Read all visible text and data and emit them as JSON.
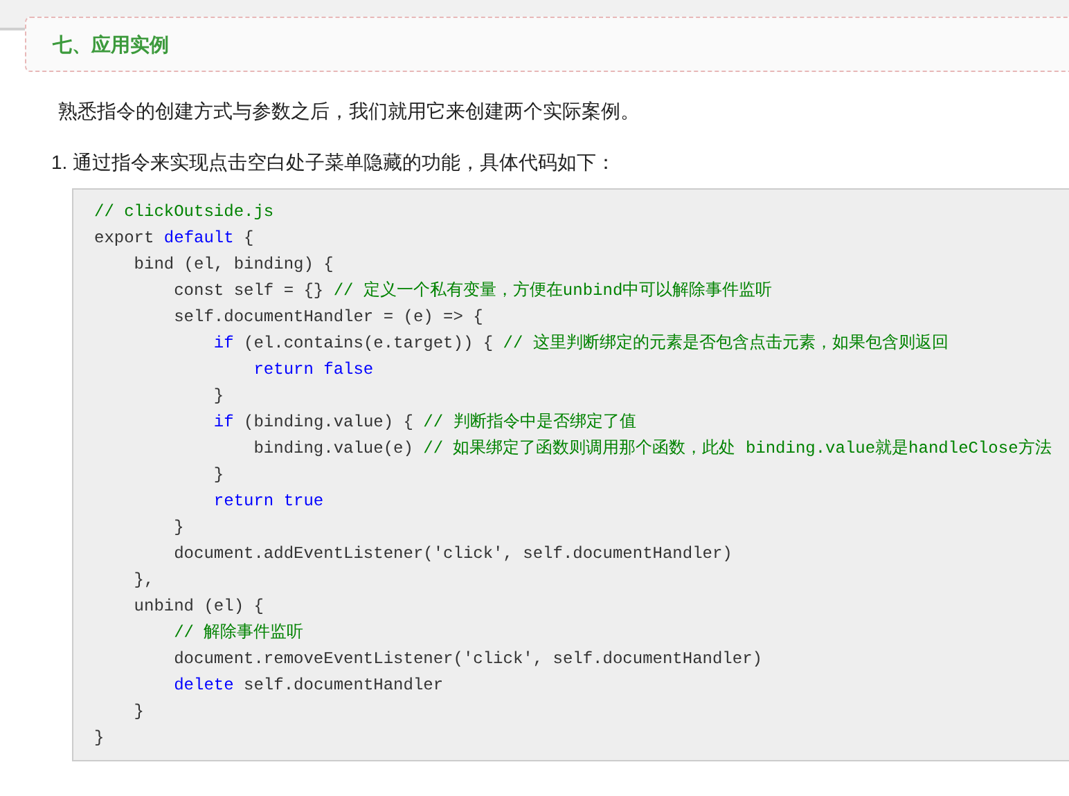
{
  "section_heading": "七、应用实例",
  "intro": "熟悉指令的创建方式与参数之后，我们就用它来创建两个实际案例。",
  "list_item": {
    "number": "1.",
    "text": "通过指令来实现点击空白处子菜单隐藏的功能，具体代码如下："
  },
  "code_lines": [
    [
      {
        "kind": "comment",
        "text": "// clickOutside.js"
      }
    ],
    [
      {
        "kind": "plain",
        "text": "export "
      },
      {
        "kind": "keyword",
        "text": "default"
      },
      {
        "kind": "plain",
        "text": " {"
      }
    ],
    [
      {
        "kind": "plain",
        "text": "    bind (el, binding) {"
      }
    ],
    [
      {
        "kind": "plain",
        "text": "        const self = {} "
      },
      {
        "kind": "comment",
        "text": "// 定义一个私有变量，方便在unbind中可以解除事件监听"
      }
    ],
    [
      {
        "kind": "plain",
        "text": "        self.documentHandler = (e) => {"
      }
    ],
    [
      {
        "kind": "keyword",
        "text": "            if"
      },
      {
        "kind": "plain",
        "text": " (el.contains(e.target)) { "
      },
      {
        "kind": "comment",
        "text": "// 这里判断绑定的元素是否包含点击元素，如果包含则返回"
      }
    ],
    [
      {
        "kind": "keyword",
        "text": "                return false"
      }
    ],
    [
      {
        "kind": "plain",
        "text": "            }"
      }
    ],
    [
      {
        "kind": "keyword",
        "text": "            if"
      },
      {
        "kind": "plain",
        "text": " (binding.value) { "
      },
      {
        "kind": "comment",
        "text": "// 判断指令中是否绑定了值"
      }
    ],
    [
      {
        "kind": "plain",
        "text": "                binding.value(e) "
      },
      {
        "kind": "comment",
        "text": "// 如果绑定了函数则调用那个函数，此处 binding.value就是handleClose方法"
      }
    ],
    [
      {
        "kind": "plain",
        "text": "            }"
      }
    ],
    [
      {
        "kind": "keyword",
        "text": "            return true"
      }
    ],
    [
      {
        "kind": "plain",
        "text": "        }"
      }
    ],
    [
      {
        "kind": "plain",
        "text": "        document.addEventListener('click', self.documentHandler)"
      }
    ],
    [
      {
        "kind": "plain",
        "text": "    },"
      }
    ],
    [
      {
        "kind": "plain",
        "text": "    unbind (el) {"
      }
    ],
    [
      {
        "kind": "comment",
        "text": "        // 解除事件监听"
      }
    ],
    [
      {
        "kind": "plain",
        "text": "        document.removeEventListener('click', self.documentHandler)"
      }
    ],
    [
      {
        "kind": "keyword",
        "text": "        delete"
      },
      {
        "kind": "plain",
        "text": " self.documentHandler"
      }
    ],
    [
      {
        "kind": "plain",
        "text": "    }"
      }
    ],
    [
      {
        "kind": "plain",
        "text": "}"
      }
    ]
  ]
}
